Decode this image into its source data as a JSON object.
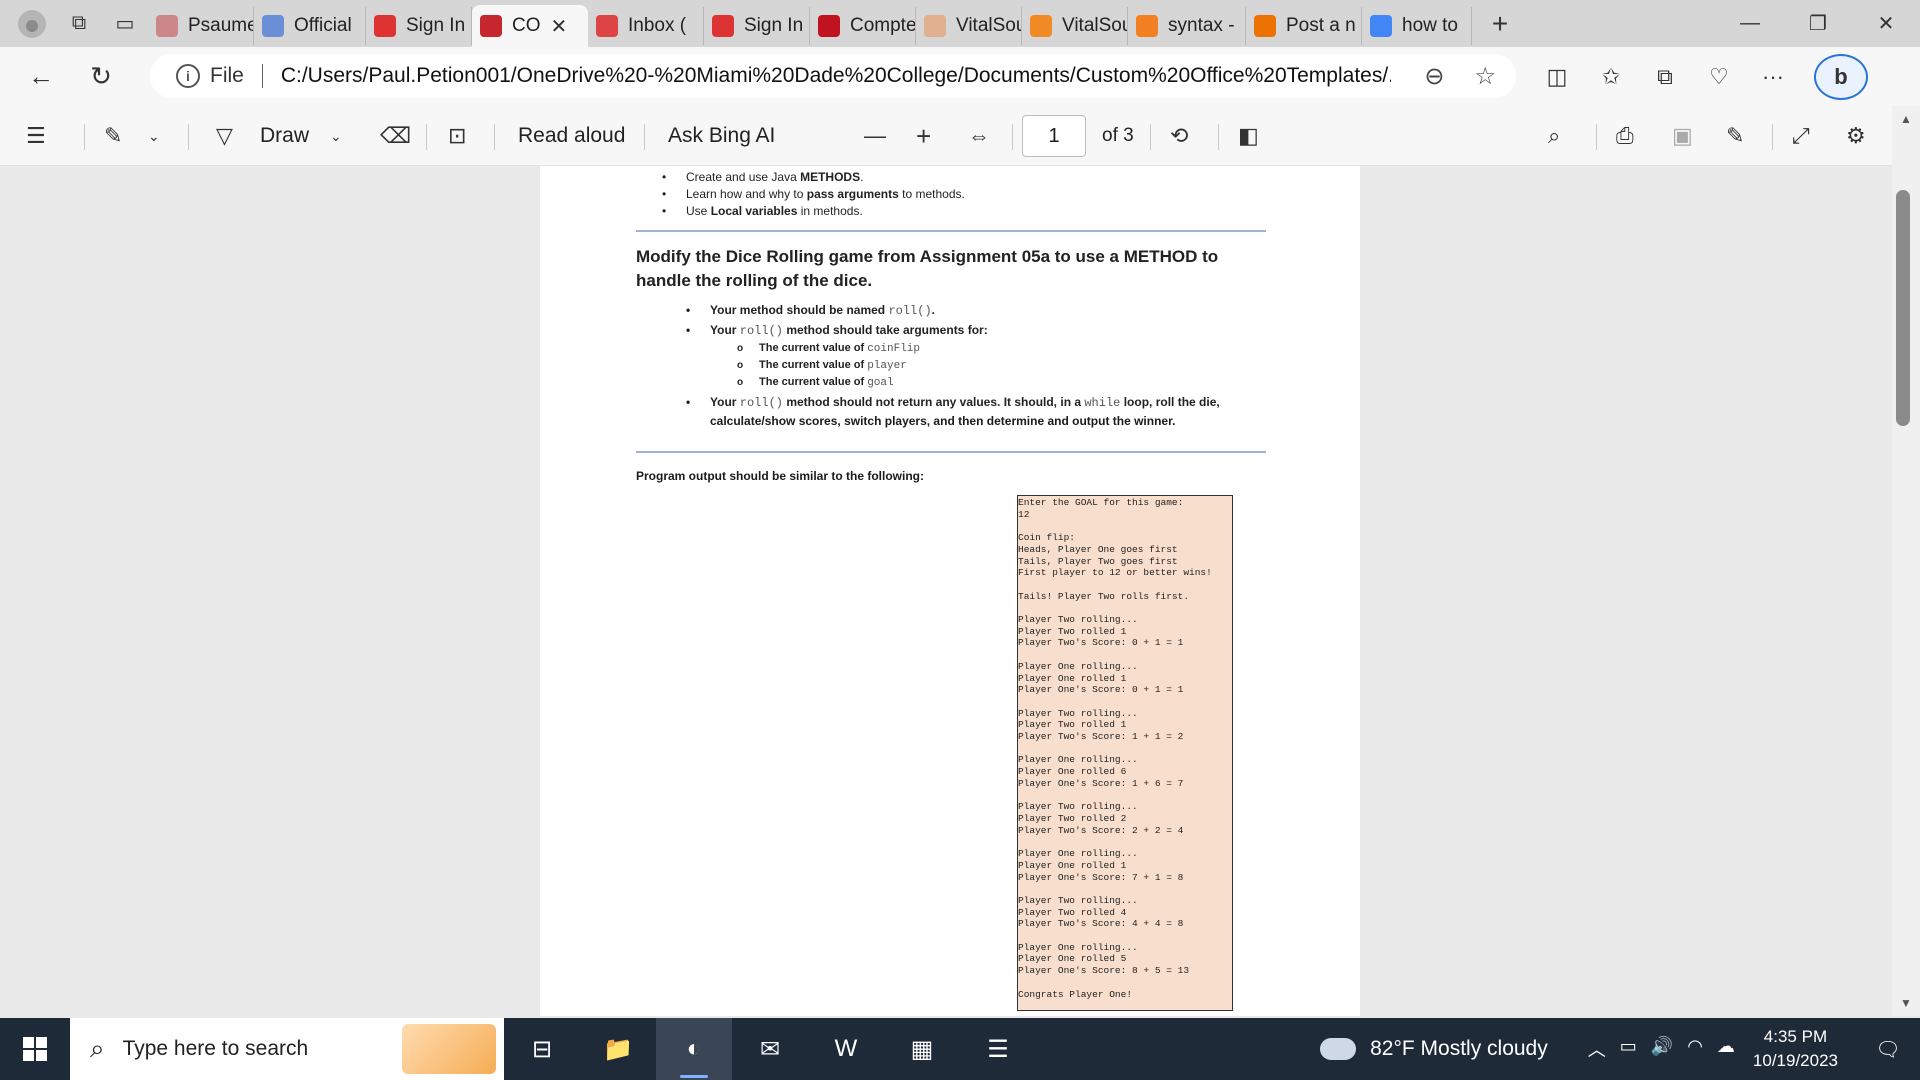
{
  "browser": {
    "tabs": [
      {
        "title": "Psaume",
        "favicon": "phone-icon",
        "color": "#c88"
      },
      {
        "title": "Official",
        "favicon": "vp-icon",
        "color": "#6b8fd6"
      },
      {
        "title": "Sign In",
        "favicon": "gear-logo-icon",
        "color": "#d33"
      },
      {
        "title": "CO",
        "favicon": "pdf-icon",
        "color": "#c6262e",
        "active": true
      },
      {
        "title": "Inbox (",
        "favicon": "gmail-icon",
        "color": "#d44"
      },
      {
        "title": "Sign In",
        "favicon": "gear-logo-icon",
        "color": "#d33"
      },
      {
        "title": "Compte",
        "favicon": "heart-icon",
        "color": "#c1121f"
      },
      {
        "title": "VitalSou",
        "favicon": "book-icon",
        "color": "#e0b090"
      },
      {
        "title": "VitalSou",
        "favicon": "book-icon",
        "color": "#f08a24"
      },
      {
        "title": "syntax -",
        "favicon": "stack-icon",
        "color": "#f48024"
      },
      {
        "title": "Post a n",
        "favicon": "chegg-icon",
        "color": "#eb7100"
      },
      {
        "title": "how to",
        "favicon": "google-icon",
        "color": "#4285f4"
      }
    ],
    "address": {
      "scheme_label": "File",
      "url": "C:/Users/Paul.Petion001/OneDrive%20-%20Miami%20Dade%20College/Documents/Custom%20Office%20Templates/..."
    }
  },
  "pdf_toolbar": {
    "draw_label": "Draw",
    "read_aloud_label": "Read aloud",
    "ask_bing_label": "Ask Bing AI",
    "page_current": "1",
    "page_total_label": "of 3"
  },
  "document": {
    "objectives": [
      {
        "pre": "Create and use Java ",
        "bold": "METHODS",
        "post": "."
      },
      {
        "pre": "Learn how and why to ",
        "bold": "pass arguments",
        "post": " to methods."
      },
      {
        "pre": "Use ",
        "bold": "Local variables",
        "post": " in methods."
      }
    ],
    "heading": "Modify the Dice Rolling game from Assignment 05a to use a METHOD to handle the rolling of the dice.",
    "req1": {
      "pre": "Your method should be named ",
      "code": "roll()",
      "post": "."
    },
    "req2": {
      "pre": "Your ",
      "code": "roll()",
      "post": " method should take arguments for:"
    },
    "args": [
      {
        "pre": "The current value of ",
        "code": "coinFlip"
      },
      {
        "pre": "The current value of ",
        "code": "player"
      },
      {
        "pre": "The current value of ",
        "code": "goal"
      }
    ],
    "req3": {
      "pre": "Your ",
      "code": "roll()",
      "mid": " method should not return any values. It should, in a ",
      "code2": "while",
      "post": " loop, roll the die,",
      "line2": "calculate/show scores, switch players, and then determine and output the winner."
    },
    "output_label": "Program output should be similar to the following:",
    "console_text": "Enter the GOAL for this game:\n12\n\nCoin flip:\nHeads, Player One goes first\nTails, Player Two goes first\nFirst player to 12 or better wins!\n\nTails! Player Two rolls first.\n\nPlayer Two rolling...\nPlayer Two rolled 1\nPlayer Two's Score: 0 + 1 = 1\n\nPlayer One rolling...\nPlayer One rolled 1\nPlayer One's Score: 0 + 1 = 1\n\nPlayer Two rolling...\nPlayer Two rolled 1\nPlayer Two's Score: 1 + 1 = 2\n\nPlayer One rolling...\nPlayer One rolled 6\nPlayer One's Score: 1 + 6 = 7\n\nPlayer Two rolling...\nPlayer Two rolled 2\nPlayer Two's Score: 2 + 2 = 4\n\nPlayer One rolling...\nPlayer One rolled 1\nPlayer One's Score: 7 + 1 = 8\n\nPlayer Two rolling...\nPlayer Two rolled 4\nPlayer Two's Score: 4 + 4 = 8\n\nPlayer One rolling...\nPlayer One rolled 5\nPlayer One's Score: 8 + 5 = 13\n\nCongrats Player One!"
  },
  "taskbar": {
    "search_placeholder": "Type here to search",
    "apps": [
      {
        "name": "task-view-icon",
        "glyph": "⊟"
      },
      {
        "name": "file-explorer-icon",
        "glyph": "📁"
      },
      {
        "name": "edge-icon",
        "glyph": "◐",
        "active": true
      },
      {
        "name": "mail-icon",
        "glyph": "✉"
      },
      {
        "name": "word-icon",
        "glyph": "W"
      },
      {
        "name": "store-icon",
        "glyph": "▦"
      },
      {
        "name": "java-ide-icon",
        "glyph": "☰"
      }
    ],
    "weather": "82°F  Mostly cloudy",
    "time": "4:35 PM",
    "date": "10/19/2023"
  }
}
